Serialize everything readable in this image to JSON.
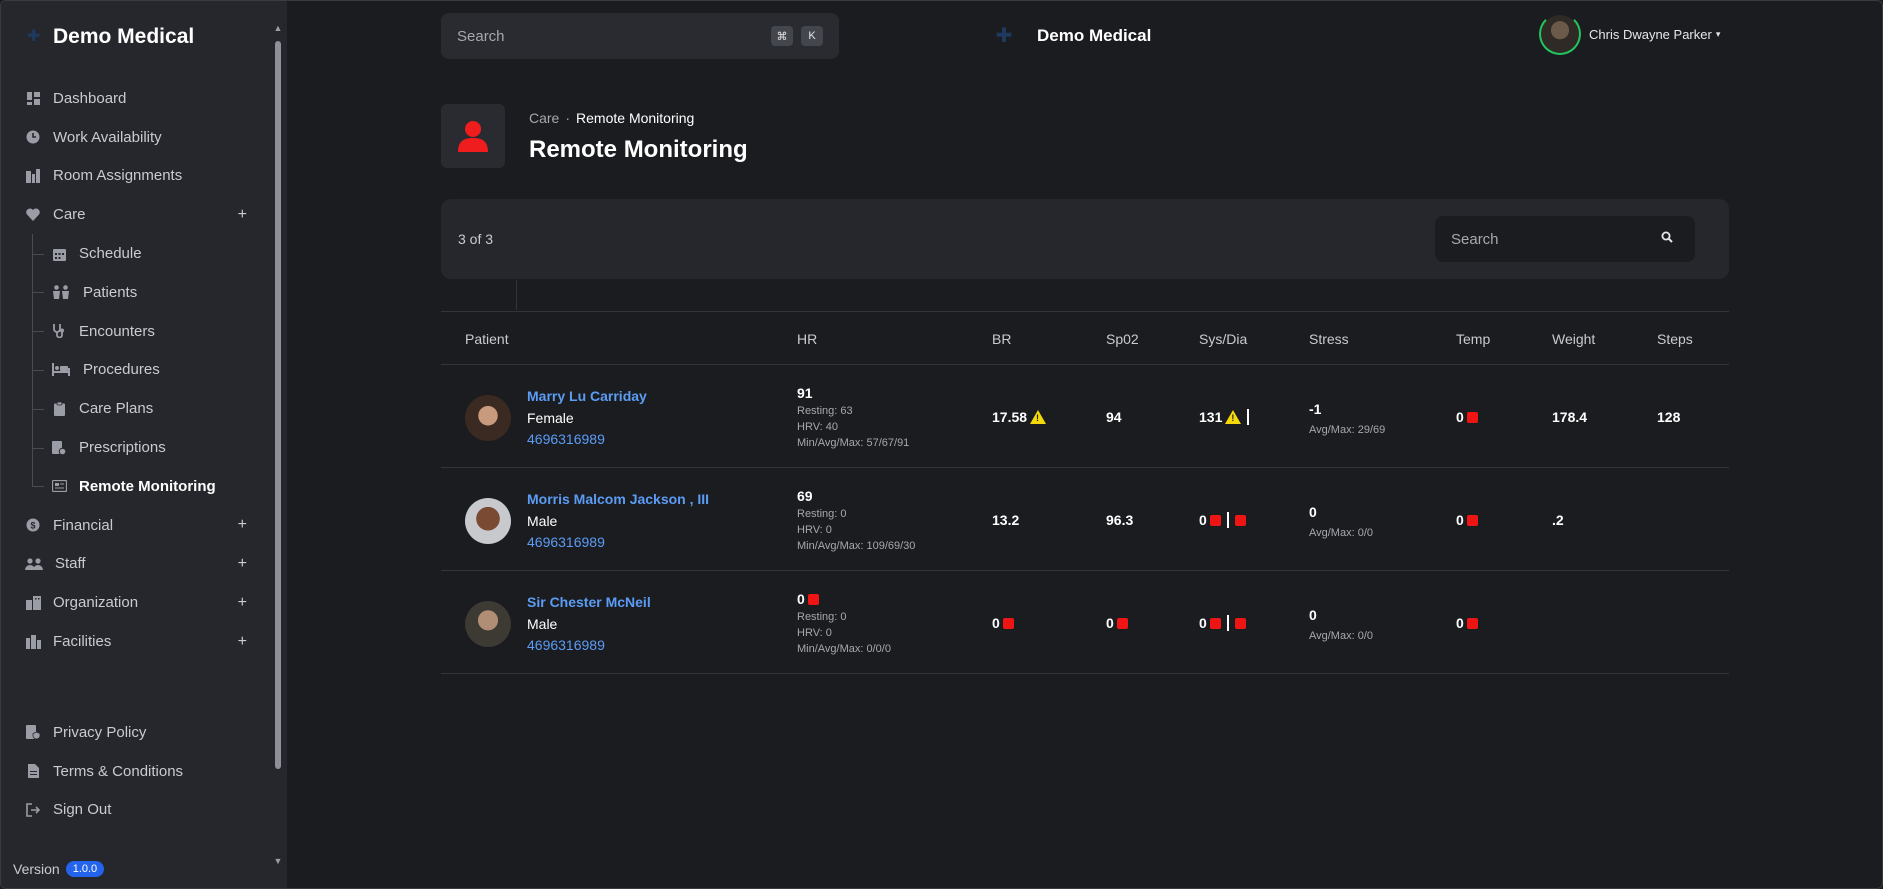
{
  "sidebar": {
    "brand": "Demo Medical",
    "items": [
      {
        "label": "Dashboard",
        "icon": "dashboard-icon"
      },
      {
        "label": "Work Availability",
        "icon": "clock-icon"
      },
      {
        "label": "Room Assignments",
        "icon": "rooms-icon"
      },
      {
        "label": "Care",
        "icon": "heart-icon",
        "expandable": true
      }
    ],
    "care_sub": [
      {
        "label": "Schedule",
        "icon": "calendar-icon"
      },
      {
        "label": "Patients",
        "icon": "patients-icon"
      },
      {
        "label": "Encounters",
        "icon": "stethoscope-icon"
      },
      {
        "label": "Procedures",
        "icon": "bed-icon"
      },
      {
        "label": "Care Plans",
        "icon": "clipboard-icon"
      },
      {
        "label": "Prescriptions",
        "icon": "prescription-icon"
      },
      {
        "label": "Remote Monitoring",
        "icon": "monitor-icon",
        "active": true
      }
    ],
    "groups": [
      {
        "label": "Financial",
        "icon": "dollar-icon"
      },
      {
        "label": "Staff",
        "icon": "staff-icon"
      },
      {
        "label": "Organization",
        "icon": "organization-icon"
      },
      {
        "label": "Facilities",
        "icon": "facilities-icon"
      }
    ],
    "bottom": [
      {
        "label": "Privacy Policy",
        "icon": "privacy-icon"
      },
      {
        "label": "Terms & Conditions",
        "icon": "document-icon"
      },
      {
        "label": "Sign Out",
        "icon": "sign-out-icon"
      }
    ],
    "plus": "+",
    "version_label": "Version",
    "version_value": "1.0.0"
  },
  "topbar": {
    "search_placeholder": "Search",
    "kbd_cmd": "⌘",
    "kbd_k": "K",
    "app_title": "Demo Medical",
    "user_name": "Chris Dwayne Parker",
    "caret": "▾"
  },
  "header": {
    "breadcrumb_parent": "Care",
    "breadcrumb_sep": "·",
    "breadcrumb_current": "Remote Monitoring",
    "title": "Remote Monitoring"
  },
  "filter": {
    "count": "3 of 3",
    "search_placeholder": "Search"
  },
  "table": {
    "columns": [
      "Patient",
      "HR",
      "BR",
      "Sp02",
      "Sys/Dia",
      "Stress",
      "Temp",
      "Weight",
      "Steps"
    ],
    "rows": [
      {
        "name": "Marry Lu Carriday",
        "gender": "Female",
        "phone": "4696316989",
        "hr": "91",
        "hr_alert": false,
        "resting": "Resting: 63",
        "hrv": "HRV: 40",
        "minavgmax": "Min/Avg/Max: 57/67/91",
        "br": "17.58",
        "br_flag": "warning",
        "spo2": "94",
        "spo2_flag": "none",
        "sys": "131",
        "sys_flag": "warning",
        "dia": "",
        "dia_flag": "none",
        "stress": "-1",
        "stress_sub": "Avg/Max: 29/69",
        "temp": "0",
        "temp_flag": "alert",
        "weight": "178.4",
        "steps": "128"
      },
      {
        "name": "Morris Malcom Jackson , III",
        "gender": "Male",
        "phone": "4696316989",
        "hr": "69",
        "hr_alert": false,
        "resting": "Resting: 0",
        "hrv": "HRV: 0",
        "minavgmax": "Min/Avg/Max: 109/69/30",
        "br": "13.2",
        "br_flag": "none",
        "spo2": "96.3",
        "spo2_flag": "none",
        "sys": "0",
        "sys_flag": "alert",
        "dia": "",
        "dia_flag": "alert",
        "stress": "0",
        "stress_sub": "Avg/Max: 0/0",
        "temp": "0",
        "temp_flag": "alert",
        "weight": ".2",
        "steps": ""
      },
      {
        "name": "Sir Chester McNeil",
        "gender": "Male",
        "phone": "4696316989",
        "hr": "0",
        "hr_alert": true,
        "resting": "Resting: 0",
        "hrv": "HRV: 0",
        "minavgmax": "Min/Avg/Max: 0/0/0",
        "br": "0",
        "br_flag": "alert",
        "spo2": "0",
        "spo2_flag": "alert",
        "sys": "0",
        "sys_flag": "alert",
        "dia": "",
        "dia_flag": "alert",
        "stress": "0",
        "stress_sub": "Avg/Max: 0/0",
        "temp": "0",
        "temp_flag": "alert",
        "weight": "",
        "steps": ""
      }
    ]
  },
  "colors": {
    "background": "#1b1c20",
    "sidebar": "#26272c",
    "link": "#5b9cf5",
    "alert": "#ef1515",
    "warning": "#f5d90a",
    "accent": "#2463eb"
  }
}
